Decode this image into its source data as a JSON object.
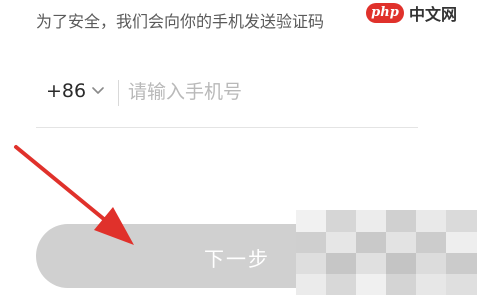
{
  "hint_text": "为了安全，我们会向你的手机发送验证码",
  "watermark": {
    "logo_text": "php",
    "site_text": "中文网"
  },
  "phone": {
    "country_code": "+86",
    "placeholder": "请输入手机号",
    "value": ""
  },
  "next_button": {
    "label": "下一步",
    "state": "disabled-gray"
  },
  "colors": {
    "annotation_arrow": "#e0312b",
    "button_bg": "#d0d0d0",
    "button_text": "#ffffff",
    "watermark_logo": "#e0312b"
  },
  "icons": {
    "country_code_dropdown": "chevron-down-icon",
    "annotation": "red-arrow-icon"
  }
}
